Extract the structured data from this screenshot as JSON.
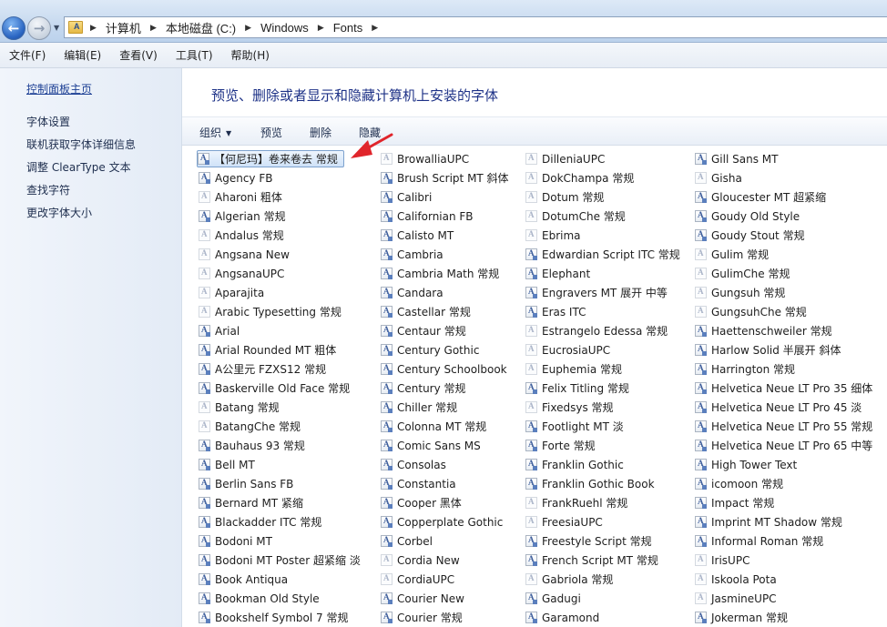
{
  "breadcrumb": [
    "计算机",
    "本地磁盘 (C:)",
    "Windows",
    "Fonts"
  ],
  "menu": [
    "文件(F)",
    "编辑(E)",
    "查看(V)",
    "工具(T)",
    "帮助(H)"
  ],
  "left_pane": {
    "home_link": "控制面板主页",
    "links": [
      "字体设置",
      "联机获取字体详细信息",
      "调整 ClearType 文本",
      "查找字符",
      "更改字体大小"
    ]
  },
  "title": "预览、删除或者显示和隐藏计算机上安装的字体",
  "toolbar": {
    "organize": "组织",
    "preview": "预览",
    "delete": "删除",
    "hide": "隐藏"
  },
  "annotation": {
    "color": "#e0252b"
  },
  "columns": [
    [
      {
        "name": "【何尼玛】卷来卷去 常规",
        "icon": "ttf",
        "selected": true
      },
      {
        "name": "Agency FB",
        "icon": "ttf"
      },
      {
        "name": "Aharoni 粗体",
        "icon": "faint"
      },
      {
        "name": "Algerian 常规",
        "icon": "ttf"
      },
      {
        "name": "Andalus 常规",
        "icon": "faint"
      },
      {
        "name": "Angsana New",
        "icon": "faint"
      },
      {
        "name": "AngsanaUPC",
        "icon": "faint"
      },
      {
        "name": "Aparajita",
        "icon": "faint"
      },
      {
        "name": "Arabic Typesetting 常规",
        "icon": "faint"
      },
      {
        "name": "Arial",
        "icon": "ttf"
      },
      {
        "name": "Arial Rounded MT 粗体",
        "icon": "ttf"
      },
      {
        "name": "A公里元 FZXS12 常规",
        "icon": "ttf"
      },
      {
        "name": "Baskerville Old Face 常规",
        "icon": "ttf"
      },
      {
        "name": "Batang 常规",
        "icon": "faint"
      },
      {
        "name": "BatangChe 常规",
        "icon": "faint"
      },
      {
        "name": "Bauhaus 93 常规",
        "icon": "ttf"
      },
      {
        "name": "Bell MT",
        "icon": "ttf"
      },
      {
        "name": "Berlin Sans FB",
        "icon": "ttf"
      },
      {
        "name": "Bernard MT 紧缩",
        "icon": "ttf"
      },
      {
        "name": "Blackadder ITC 常规",
        "icon": "ttf"
      },
      {
        "name": "Bodoni MT",
        "icon": "ttf"
      },
      {
        "name": "Bodoni MT Poster 超紧缩 淡",
        "icon": "ttf"
      },
      {
        "name": "Book Antiqua",
        "icon": "ttf"
      },
      {
        "name": "Bookman Old Style",
        "icon": "ttf"
      },
      {
        "name": "Bookshelf Symbol 7 常规",
        "icon": "ttf"
      }
    ],
    [
      {
        "name": "BrowalliaUPC",
        "icon": "faint"
      },
      {
        "name": "Brush Script MT 斜体",
        "icon": "ttf"
      },
      {
        "name": "Calibri",
        "icon": "ttf"
      },
      {
        "name": "Californian FB",
        "icon": "ttf"
      },
      {
        "name": "Calisto MT",
        "icon": "ttf"
      },
      {
        "name": "Cambria",
        "icon": "ttf"
      },
      {
        "name": "Cambria Math 常规",
        "icon": "ttf"
      },
      {
        "name": "Candara",
        "icon": "ttf"
      },
      {
        "name": "Castellar 常规",
        "icon": "ttf"
      },
      {
        "name": "Centaur 常规",
        "icon": "ttf"
      },
      {
        "name": "Century Gothic",
        "icon": "ttf"
      },
      {
        "name": "Century Schoolbook",
        "icon": "ttf"
      },
      {
        "name": "Century 常规",
        "icon": "ttf"
      },
      {
        "name": "Chiller 常规",
        "icon": "ttf"
      },
      {
        "name": "Colonna MT 常规",
        "icon": "ttf"
      },
      {
        "name": "Comic Sans MS",
        "icon": "ttf"
      },
      {
        "name": "Consolas",
        "icon": "ttf"
      },
      {
        "name": "Constantia",
        "icon": "ttf"
      },
      {
        "name": "Cooper 黑体",
        "icon": "ttf"
      },
      {
        "name": "Copperplate Gothic",
        "icon": "ttf"
      },
      {
        "name": "Corbel",
        "icon": "ttf"
      },
      {
        "name": "Cordia New",
        "icon": "faint"
      },
      {
        "name": "CordiaUPC",
        "icon": "faint"
      },
      {
        "name": "Courier New",
        "icon": "ttf"
      },
      {
        "name": "Courier 常规",
        "icon": "ttf"
      }
    ],
    [
      {
        "name": "DilleniaUPC",
        "icon": "faint"
      },
      {
        "name": "DokChampa 常规",
        "icon": "faint"
      },
      {
        "name": "Dotum 常规",
        "icon": "faint"
      },
      {
        "name": "DotumChe 常规",
        "icon": "faint"
      },
      {
        "name": "Ebrima",
        "icon": "faint"
      },
      {
        "name": "Edwardian Script ITC 常规",
        "icon": "ttf"
      },
      {
        "name": "Elephant",
        "icon": "ttf"
      },
      {
        "name": "Engravers MT 展开 中等",
        "icon": "ttf"
      },
      {
        "name": "Eras ITC",
        "icon": "ttf"
      },
      {
        "name": "Estrangelo Edessa 常规",
        "icon": "faint"
      },
      {
        "name": "EucrosiaUPC",
        "icon": "faint"
      },
      {
        "name": "Euphemia 常规",
        "icon": "faint"
      },
      {
        "name": "Felix Titling 常规",
        "icon": "ttf"
      },
      {
        "name": "Fixedsys 常规",
        "icon": "faint"
      },
      {
        "name": "Footlight MT 淡",
        "icon": "ttf"
      },
      {
        "name": "Forte 常规",
        "icon": "ttf"
      },
      {
        "name": "Franklin Gothic",
        "icon": "ttf"
      },
      {
        "name": "Franklin Gothic Book",
        "icon": "ttf"
      },
      {
        "name": "FrankRuehl 常规",
        "icon": "faint"
      },
      {
        "name": "FreesiaUPC",
        "icon": "faint"
      },
      {
        "name": "Freestyle Script 常规",
        "icon": "ttf"
      },
      {
        "name": "French Script MT 常规",
        "icon": "ttf"
      },
      {
        "name": "Gabriola 常规",
        "icon": "faint"
      },
      {
        "name": "Gadugi",
        "icon": "ttf"
      },
      {
        "name": "Garamond",
        "icon": "ttf"
      }
    ],
    [
      {
        "name": "Gill Sans MT",
        "icon": "ttf"
      },
      {
        "name": "Gisha",
        "icon": "faint"
      },
      {
        "name": "Gloucester MT 超紧缩",
        "icon": "ttf"
      },
      {
        "name": "Goudy Old Style",
        "icon": "ttf"
      },
      {
        "name": "Goudy Stout 常规",
        "icon": "ttf"
      },
      {
        "name": "Gulim 常规",
        "icon": "faint"
      },
      {
        "name": "GulimChe 常规",
        "icon": "faint"
      },
      {
        "name": "Gungsuh 常规",
        "icon": "faint"
      },
      {
        "name": "GungsuhChe 常规",
        "icon": "faint"
      },
      {
        "name": "Haettenschweiler 常规",
        "icon": "ttf"
      },
      {
        "name": "Harlow Solid 半展开 斜体",
        "icon": "ttf"
      },
      {
        "name": "Harrington 常规",
        "icon": "ttf"
      },
      {
        "name": "Helvetica Neue LT Pro 35 细体",
        "icon": "ttf"
      },
      {
        "name": "Helvetica Neue LT Pro 45 淡",
        "icon": "ttf"
      },
      {
        "name": "Helvetica Neue LT Pro 55 常规",
        "icon": "ttf"
      },
      {
        "name": "Helvetica Neue LT Pro 65 中等",
        "icon": "ttf"
      },
      {
        "name": "High Tower Text",
        "icon": "ttf"
      },
      {
        "name": "icomoon 常规",
        "icon": "ttf"
      },
      {
        "name": "Impact 常规",
        "icon": "ttf"
      },
      {
        "name": "Imprint MT Shadow 常规",
        "icon": "ttf"
      },
      {
        "name": "Informal Roman 常规",
        "icon": "ttf"
      },
      {
        "name": "IrisUPC",
        "icon": "faint"
      },
      {
        "name": "Iskoola Pota",
        "icon": "faint"
      },
      {
        "name": "JasmineUPC",
        "icon": "faint"
      },
      {
        "name": "Jokerman 常规",
        "icon": "ttf"
      }
    ]
  ]
}
